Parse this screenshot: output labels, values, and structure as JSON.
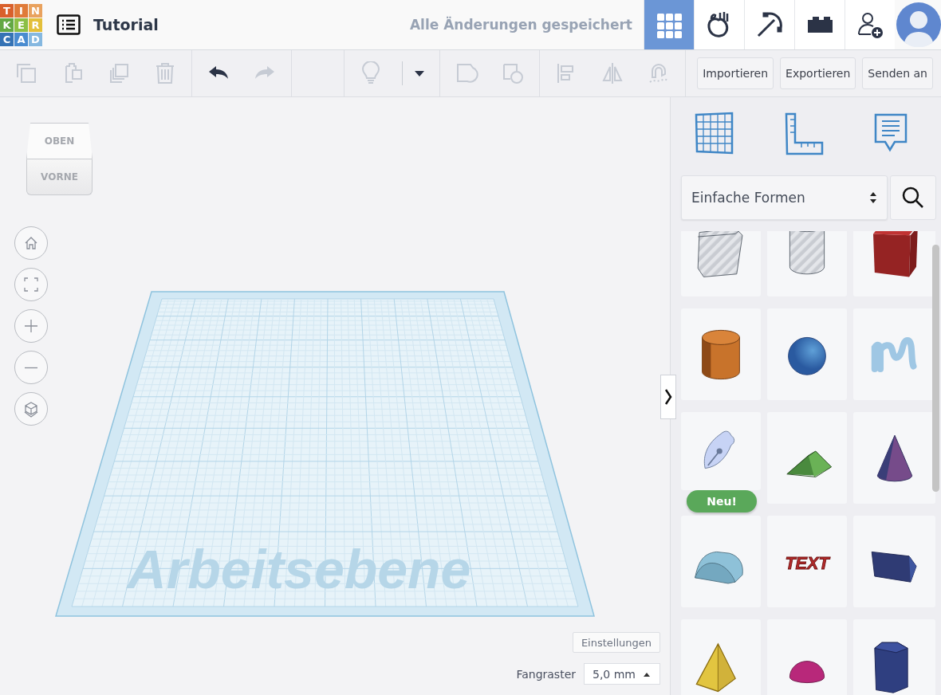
{
  "logo": {
    "letters": [
      {
        "text": "T",
        "color": "#d9602b"
      },
      {
        "text": "I",
        "color": "#e07b39"
      },
      {
        "text": "N",
        "color": "#e9a25e"
      },
      {
        "text": "K",
        "color": "#63a844"
      },
      {
        "text": "E",
        "color": "#8cbf45"
      },
      {
        "text": "R",
        "color": "#e3bf3a"
      },
      {
        "text": "C",
        "color": "#3573b5"
      },
      {
        "text": "A",
        "color": "#4a8cd0"
      },
      {
        "text": "D",
        "color": "#85b8e0"
      }
    ]
  },
  "header": {
    "title": "Tutorial",
    "save_status": "Alle Änderungen gespeichert"
  },
  "view_modes": [
    {
      "kind": "grid",
      "selected": true
    },
    {
      "kind": "apple",
      "selected": false
    },
    {
      "kind": "pickaxe",
      "selected": false
    },
    {
      "kind": "brick",
      "selected": false
    }
  ],
  "toolbar": {
    "groups": [
      {
        "tools": [
          {
            "kind": "copy",
            "disabled": true
          },
          {
            "kind": "paste",
            "disabled": true
          },
          {
            "kind": "duplicate",
            "disabled": true
          },
          {
            "kind": "delete",
            "disabled": true
          }
        ]
      },
      {
        "tools": [
          {
            "kind": "undo",
            "disabled": false
          },
          {
            "kind": "redo",
            "disabled": true
          }
        ]
      },
      {
        "tools": [
          {
            "kind": "bulb",
            "disabled": true
          },
          {
            "kind": "caret",
            "disabled": false
          }
        ]
      },
      {
        "tools": [
          {
            "kind": "group",
            "disabled": true
          },
          {
            "kind": "ungroup",
            "disabled": true
          }
        ]
      },
      {
        "tools": [
          {
            "kind": "align",
            "disabled": true
          },
          {
            "kind": "mirror",
            "disabled": true
          },
          {
            "kind": "magnet",
            "disabled": true
          }
        ]
      }
    ],
    "actions": [
      "Importieren",
      "Exportieren",
      "Senden an"
    ]
  },
  "view_cube": {
    "top": "OBEN",
    "front": "VORNE"
  },
  "nav_controls": [
    {
      "kind": "home"
    },
    {
      "kind": "fit"
    },
    {
      "kind": "zoom-in"
    },
    {
      "kind": "zoom-out"
    },
    {
      "kind": "perspective"
    }
  ],
  "workplane": {
    "label": "Arbeitsebene"
  },
  "settings_button": "Einstellungen",
  "snap_grid": {
    "label": "Fangraster",
    "value": "5,0 mm"
  },
  "panel": {
    "tools": [
      {
        "kind": "workplane"
      },
      {
        "kind": "ruler"
      },
      {
        "kind": "notes"
      }
    ],
    "library": {
      "value": "Einfache Formen"
    },
    "shapes": [
      {
        "kind": "box-hole"
      },
      {
        "kind": "cylinder-hole"
      },
      {
        "kind": "box"
      },
      {
        "kind": "cylinder"
      },
      {
        "kind": "sphere"
      },
      {
        "kind": "scribble"
      },
      {
        "kind": "sketch",
        "badge": "Neu!"
      },
      {
        "kind": "roof"
      },
      {
        "kind": "cone"
      },
      {
        "kind": "round-roof"
      },
      {
        "kind": "text",
        "label": "TEXT"
      },
      {
        "kind": "prism"
      },
      {
        "kind": "pyramid"
      },
      {
        "kind": "half-sphere"
      },
      {
        "kind": "polygon"
      }
    ]
  }
}
